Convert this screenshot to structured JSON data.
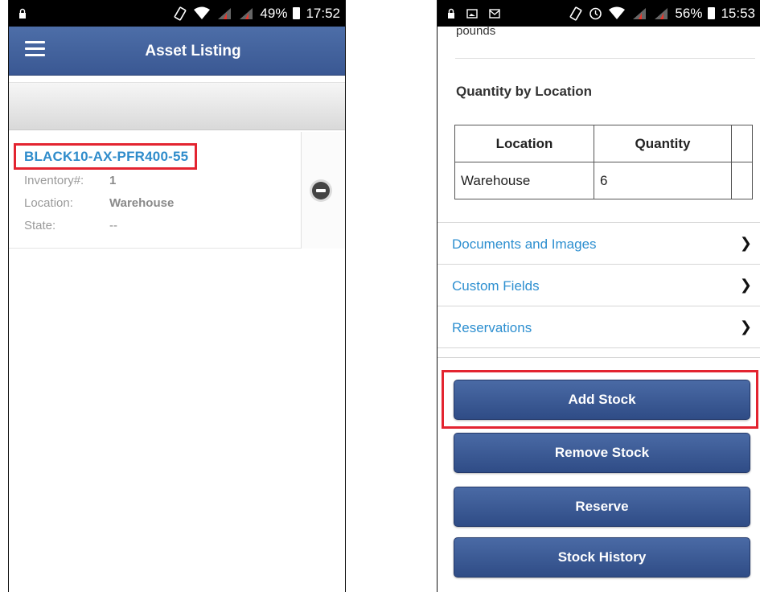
{
  "left_screen": {
    "status": {
      "battery": "49%",
      "time": "17:52"
    },
    "header": {
      "title": "Asset Listing"
    },
    "asset": {
      "title": "BLACK10-AX-PFR400-55",
      "fields": [
        {
          "label": "Inventory#:",
          "value": "1"
        },
        {
          "label": "Location:",
          "value": "Warehouse"
        },
        {
          "label": "State:",
          "value": "--"
        }
      ]
    }
  },
  "right_screen": {
    "status": {
      "battery": "56%",
      "time": "15:53"
    },
    "cut_text": "pounds",
    "section_heading": "Quantity by Location",
    "table": {
      "headers": [
        "Location",
        "Quantity",
        ""
      ],
      "rows": [
        [
          "Warehouse",
          "6",
          ""
        ]
      ]
    },
    "links": [
      {
        "label": "Documents and Images"
      },
      {
        "label": "Custom Fields"
      },
      {
        "label": "Reservations"
      }
    ],
    "buttons": [
      {
        "label": "Add Stock"
      },
      {
        "label": "Remove Stock"
      },
      {
        "label": "Reserve"
      },
      {
        "label": "Stock History"
      }
    ]
  },
  "icons": {
    "lock": "lock-icon",
    "vibrate": "vibrate-icon",
    "wifi": "wifi-icon",
    "signal": "signal-icon",
    "battery": "battery-icon",
    "alarm": "alarm-icon",
    "image": "image-notification-icon",
    "mail": "mail-icon",
    "menu": "hamburger-menu-icon",
    "remove": "remove-circle-icon",
    "chevron": "chevron-right-icon"
  },
  "colors": {
    "header_bg": "#3f5f9a",
    "link": "#2d8fd0",
    "highlight": "#e32430",
    "button_bg": "#3b5994"
  }
}
